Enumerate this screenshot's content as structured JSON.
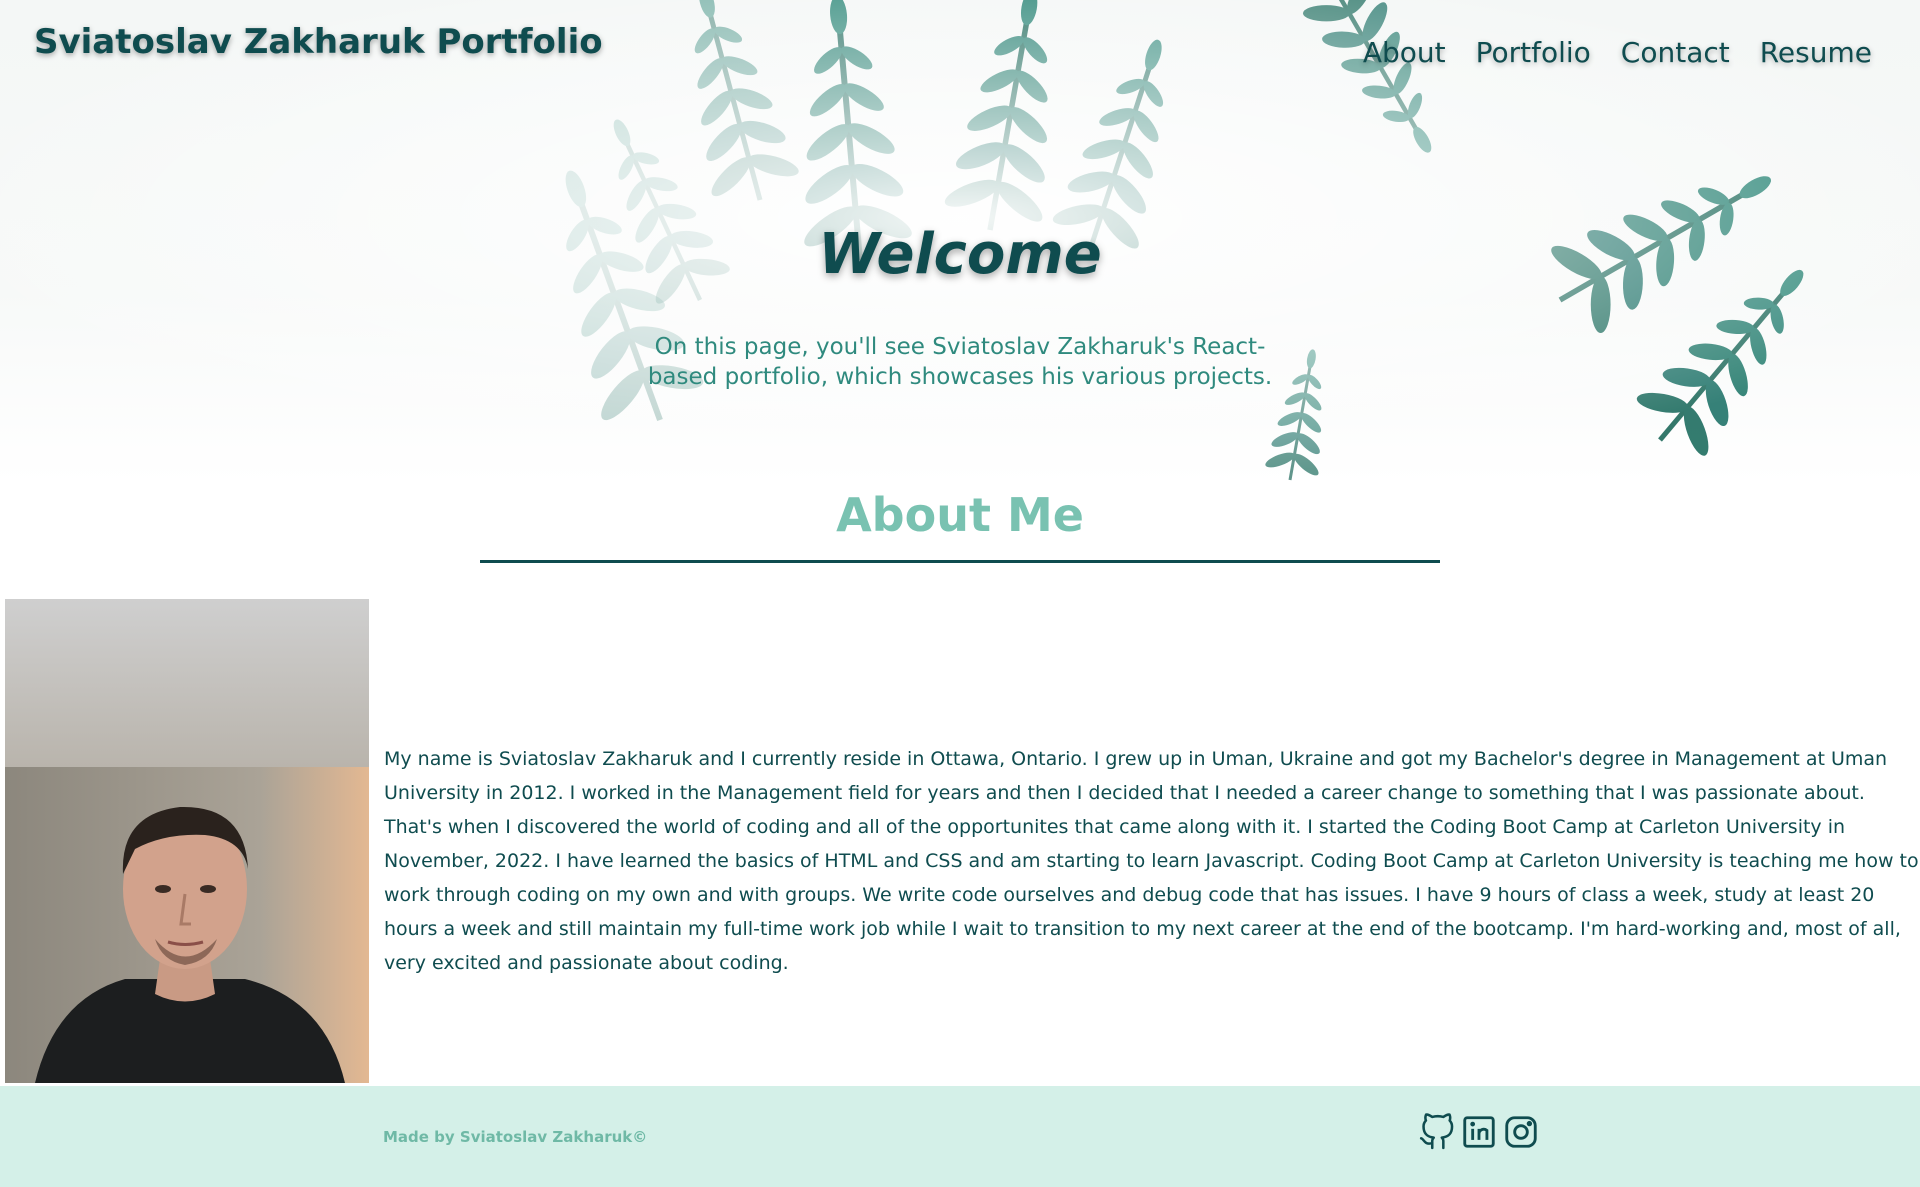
{
  "header": {
    "site_title": "Sviatoslav Zakharuk Portfolio",
    "nav": [
      {
        "label": "About"
      },
      {
        "label": "Portfolio"
      },
      {
        "label": "Contact"
      },
      {
        "label": "Resume"
      }
    ]
  },
  "hero": {
    "heading": "Welcome",
    "subtitle": "On this page, you'll see Sviatoslav Zakharuk's React-based portfolio, which showcases his various projects."
  },
  "about": {
    "title": "About Me",
    "bio": "My name is Sviatoslav Zakharuk and I currently reside in Ottawa, Ontario. I grew up in Uman, Ukraine and got my Bachelor's degree in Management at Uman University in 2012. I worked in the Management field for years and then I decided that I needed a career change to something that I was passionate about. That's when I discovered the world of coding and all of the opportunites that came along with it. I started the Coding Boot Camp at Carleton University in November, 2022. I have learned the basics of HTML and CSS and am starting to learn Javascript. Coding Boot Camp at Carleton University is teaching me how to work through coding on my own and with groups. We write code ourselves and debug code that has issues. I have 9 hours of class a week, study at least 20 hours a week and still maintain my full-time work job while I wait to transition to my next career at the end of the bootcamp. I'm hard-working and, most of all, very excited and passionate about coding."
  },
  "footer": {
    "credit": "Made by Sviatoslav Zakharuk©",
    "social_icons": [
      "github-icon",
      "linkedin-icon",
      "instagram-icon"
    ]
  },
  "colors": {
    "primary": "#0f4c4f",
    "accent": "#79c2b1",
    "subtitle": "#2f8a7e",
    "footer_bg": "#d4f0e8"
  }
}
